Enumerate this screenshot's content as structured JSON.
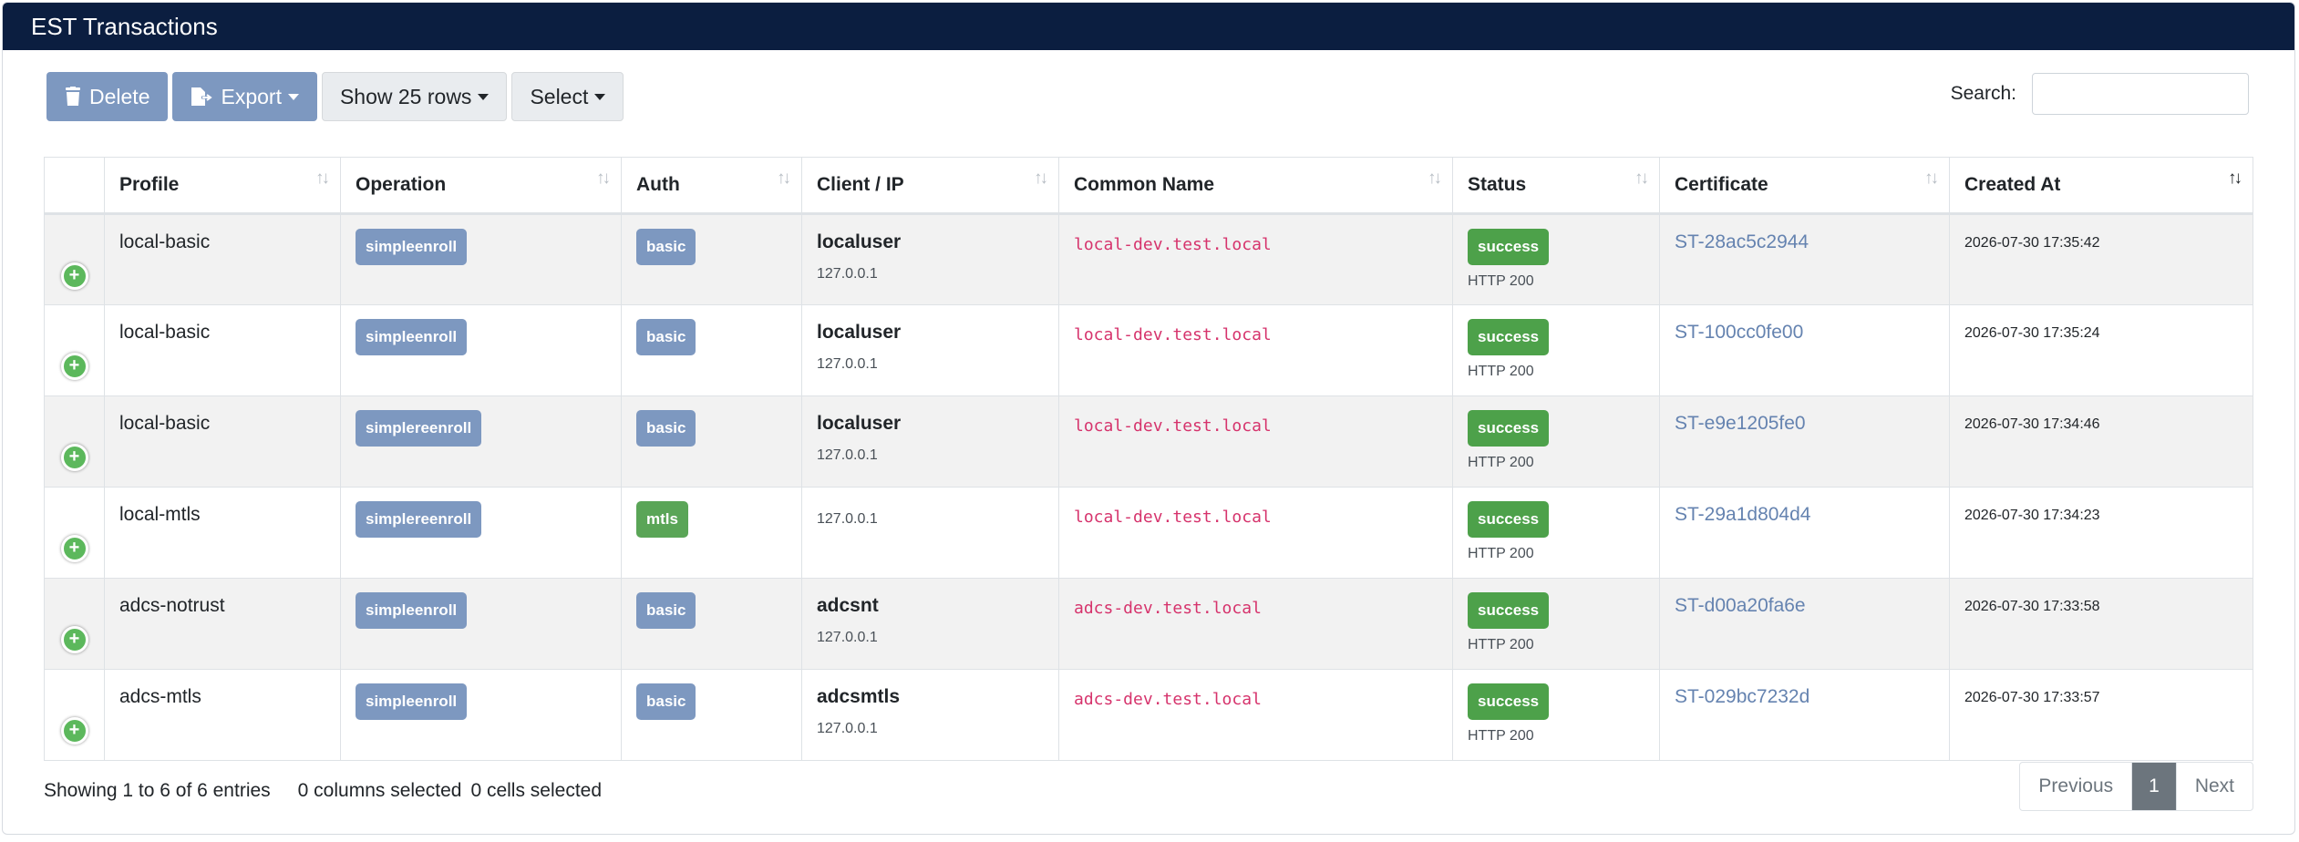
{
  "header": {
    "title": "EST Transactions"
  },
  "toolbar": {
    "delete_label": "Delete",
    "export_label": "Export",
    "rows_label": "Show 25 rows",
    "select_label": "Select"
  },
  "search": {
    "label": "Search:",
    "value": ""
  },
  "table": {
    "columns": [
      "Profile",
      "Operation",
      "Auth",
      "Client / IP",
      "Common Name",
      "Status",
      "Certificate",
      "Created At"
    ],
    "rows": [
      {
        "profile": "local-basic",
        "operation": "simpleenroll",
        "auth": "basic",
        "client_user": "localuser",
        "client_ip": "127.0.0.1",
        "common_name": "local-dev.test.local",
        "status": "success",
        "http": "HTTP 200",
        "certificate": "ST-28ac5c2944",
        "created_at": "2026-07-30 17:35:42"
      },
      {
        "profile": "local-basic",
        "operation": "simpleenroll",
        "auth": "basic",
        "client_user": "localuser",
        "client_ip": "127.0.0.1",
        "common_name": "local-dev.test.local",
        "status": "success",
        "http": "HTTP 200",
        "certificate": "ST-100cc0fe00",
        "created_at": "2026-07-30 17:35:24"
      },
      {
        "profile": "local-basic",
        "operation": "simplereenroll",
        "auth": "basic",
        "client_user": "localuser",
        "client_ip": "127.0.0.1",
        "common_name": "local-dev.test.local",
        "status": "success",
        "http": "HTTP 200",
        "certificate": "ST-e9e1205fe0",
        "created_at": "2026-07-30 17:34:46"
      },
      {
        "profile": "local-mtls",
        "operation": "simplereenroll",
        "auth": "mtls",
        "client_user": "",
        "client_ip": "127.0.0.1",
        "common_name": "local-dev.test.local",
        "status": "success",
        "http": "HTTP 200",
        "certificate": "ST-29a1d804d4",
        "created_at": "2026-07-30 17:34:23"
      },
      {
        "profile": "adcs-notrust",
        "operation": "simpleenroll",
        "auth": "basic",
        "client_user": "adcsnt",
        "client_ip": "127.0.0.1",
        "common_name": "adcs-dev.test.local",
        "status": "success",
        "http": "HTTP 200",
        "certificate": "ST-d00a20fa6e",
        "created_at": "2026-07-30 17:33:58"
      },
      {
        "profile": "adcs-mtls",
        "operation": "simpleenroll",
        "auth": "basic",
        "client_user": "adcsmtls",
        "client_ip": "127.0.0.1",
        "common_name": "adcs-dev.test.local",
        "status": "success",
        "http": "HTTP 200",
        "certificate": "ST-029bc7232d",
        "created_at": "2026-07-30 17:33:57"
      }
    ]
  },
  "footer": {
    "info": "Showing 1 to 6 of 6 entries",
    "columns_selected": "0 columns selected",
    "cells_selected": "0 cells selected"
  },
  "pagination": {
    "previous": "Previous",
    "current": "1",
    "next": "Next"
  },
  "colors": {
    "header_bg": "#0b1e40",
    "primary": "#7d98c0",
    "success": "#4da14a",
    "code": "#d6336c",
    "link": "#6583b0"
  }
}
